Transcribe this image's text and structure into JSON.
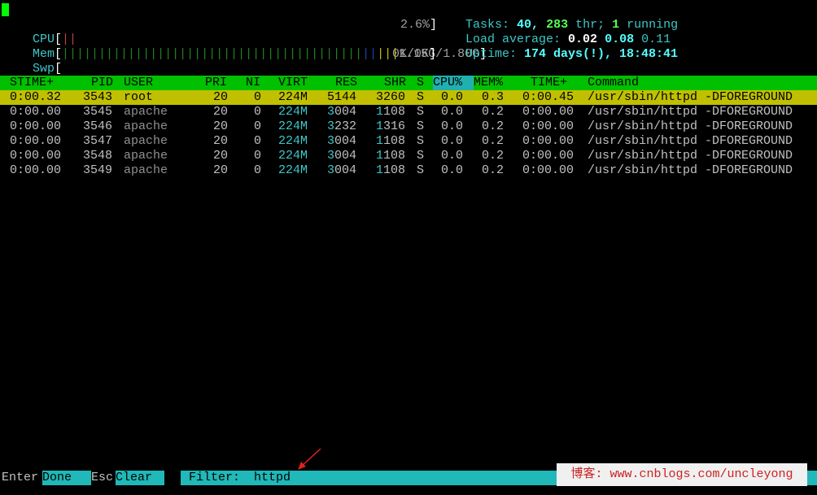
{
  "meters": {
    "cpu": {
      "label": "CPU",
      "bar": "||",
      "value": "2.6%"
    },
    "mem": {
      "label": "Mem",
      "bar_green": "|||||||||||||||||||||||||||||||||||||||||",
      "bar_blue": "||",
      "bar_yellow": "|||",
      "value": "1.15G/1.80G"
    },
    "swp": {
      "label": "Swp",
      "value": "0K/0K"
    }
  },
  "stats": {
    "tasks_label": "Tasks:",
    "tasks_count": "40,",
    "threads": "283",
    "thr_label": "thr;",
    "running_count": "1",
    "running_label": "running",
    "load_label": "Load average:",
    "load1": "0.02",
    "load5": "0.08",
    "load15": "0.11",
    "uptime_label": "Uptime:",
    "uptime_value": "174 days(!), 18:48:41"
  },
  "columns": [
    "STIME+",
    "PID",
    "USER",
    "PRI",
    "NI",
    "VIRT",
    "RES",
    "SHR",
    "S",
    "CPU%",
    "MEM%",
    "TIME+",
    "Command"
  ],
  "sorted_column": "CPU%",
  "processes": [
    {
      "stime": "0:00.32",
      "pid": "3543",
      "user": "root",
      "pri": "20",
      "ni": "0",
      "virt": "224M",
      "res": "5144",
      "shr": "3260",
      "s": "S",
      "cpu": "0.0",
      "mem": "0.3",
      "time": "0:00.45",
      "command": "/usr/sbin/httpd -DFOREGROUND",
      "selected": true
    },
    {
      "stime": "0:00.00",
      "pid": "3545",
      "user": "apache",
      "pri": "20",
      "ni": "0",
      "virt": "224M",
      "res": "3004",
      "shr": "1108",
      "s": "S",
      "cpu": "0.0",
      "mem": "0.2",
      "time": "0:00.00",
      "command": "/usr/sbin/httpd -DFOREGROUND"
    },
    {
      "stime": "0:00.00",
      "pid": "3546",
      "user": "apache",
      "pri": "20",
      "ni": "0",
      "virt": "224M",
      "res": "3232",
      "shr": "1316",
      "s": "S",
      "cpu": "0.0",
      "mem": "0.2",
      "time": "0:00.00",
      "command": "/usr/sbin/httpd -DFOREGROUND"
    },
    {
      "stime": "0:00.00",
      "pid": "3547",
      "user": "apache",
      "pri": "20",
      "ni": "0",
      "virt": "224M",
      "res": "3004",
      "shr": "1108",
      "s": "S",
      "cpu": "0.0",
      "mem": "0.2",
      "time": "0:00.00",
      "command": "/usr/sbin/httpd -DFOREGROUND"
    },
    {
      "stime": "0:00.00",
      "pid": "3548",
      "user": "apache",
      "pri": "20",
      "ni": "0",
      "virt": "224M",
      "res": "3004",
      "shr": "1108",
      "s": "S",
      "cpu": "0.0",
      "mem": "0.2",
      "time": "0:00.00",
      "command": "/usr/sbin/httpd -DFOREGROUND"
    },
    {
      "stime": "0:00.00",
      "pid": "3549",
      "user": "apache",
      "pri": "20",
      "ni": "0",
      "virt": "224M",
      "res": "3004",
      "shr": "1108",
      "s": "S",
      "cpu": "0.0",
      "mem": "0.2",
      "time": "0:00.00",
      "command": "/usr/sbin/httpd -DFOREGROUND"
    }
  ],
  "footer": {
    "enter_key": "Enter",
    "enter_label": "Done  ",
    "esc_key": "Esc",
    "esc_label": "Clear  ",
    "filter_label": "Filter:",
    "filter_value": "httpd"
  },
  "watermark": "博客: www.cnblogs.com/uncleyong",
  "colors": {
    "header_bg": "#00c000",
    "selected_bg": "#c0c000",
    "filter_bg": "#20b8b8",
    "cursor": "#00ff00"
  },
  "icons": {
    "cursor": "terminal-cursor-block",
    "annotation": "red-arrow-icon"
  }
}
